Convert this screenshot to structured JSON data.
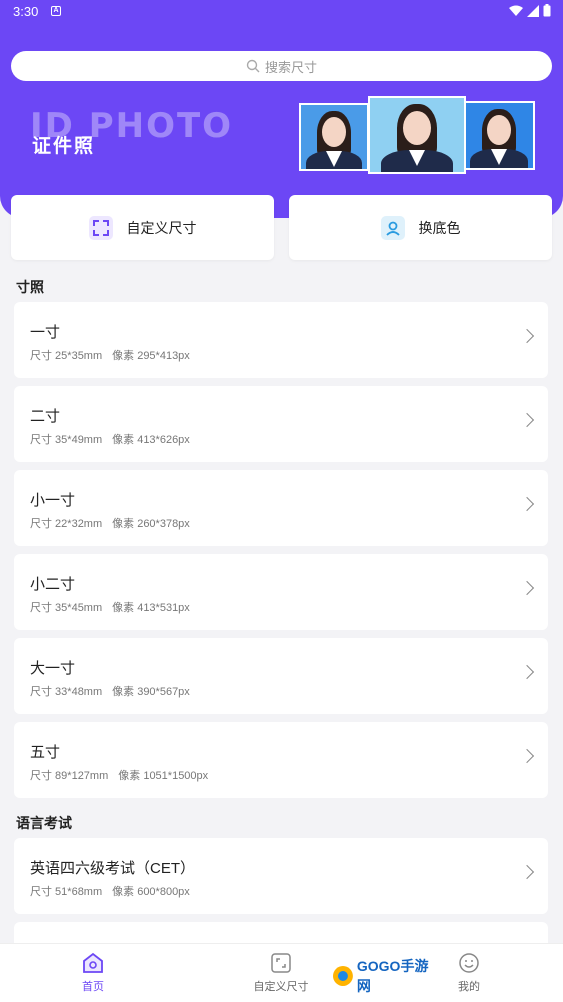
{
  "status": {
    "time": "3:30",
    "notif": "A"
  },
  "search": {
    "placeholder": "搜索尺寸"
  },
  "banner": {
    "en": "ID PHOTO",
    "cn": "证件照"
  },
  "quick": {
    "custom_label": "自定义尺寸",
    "bg_label": "换底色",
    "accent": "#6c47f5"
  },
  "sections": {
    "s1": "寸照",
    "s2": "语言考试"
  },
  "sizes": [
    {
      "name": "一寸",
      "size": "尺寸 25*35mm",
      "pixels": "像素 295*413px"
    },
    {
      "name": "二寸",
      "size": "尺寸 35*49mm",
      "pixels": "像素 413*626px"
    },
    {
      "name": "小一寸",
      "size": "尺寸 22*32mm",
      "pixels": "像素 260*378px"
    },
    {
      "name": "小二寸",
      "size": "尺寸 35*45mm",
      "pixels": "像素 413*531px"
    },
    {
      "name": "大一寸",
      "size": "尺寸 33*48mm",
      "pixels": "像素 390*567px"
    },
    {
      "name": "五寸",
      "size": "尺寸 89*127mm",
      "pixels": "像素 1051*1500px"
    }
  ],
  "exams": [
    {
      "name": "英语四六级考试（CET）",
      "size": "尺寸 51*68mm",
      "pixels": "像素 600*800px"
    }
  ],
  "tabs": {
    "home": "首页",
    "custom": "自定义尺寸",
    "mine": "我的"
  },
  "watermark": {
    "text": "GOGO手游网"
  }
}
